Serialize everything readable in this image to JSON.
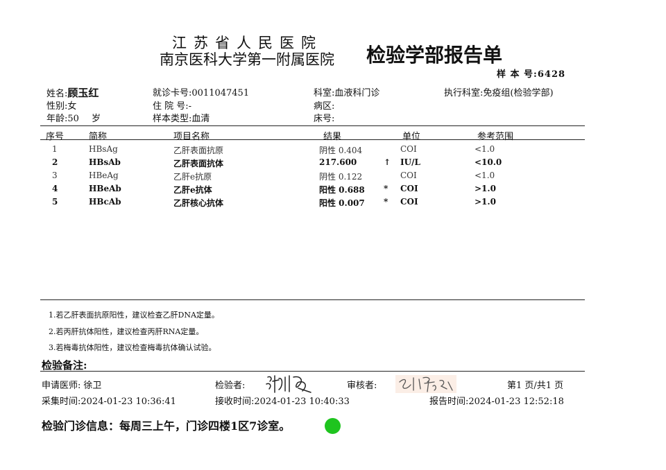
{
  "header": {
    "hospital_line1": "江苏省人民医院",
    "hospital_line2": "南京医科大学第一附属医院",
    "report_title": "检验学部报告单",
    "sample_label": "样 本 号:",
    "sample_no": "6428"
  },
  "patient": {
    "name_label": "姓名:",
    "name": "顾玉红",
    "card_label": "就诊卡号:",
    "card_no": "0011047451",
    "dept_label": "科室:",
    "dept": "血液科门诊",
    "exec_dept_label": "执行科室:",
    "exec_dept": "免疫组(检验学部)",
    "sex_label": "性别:",
    "sex": "女",
    "admission_label": "住 院 号:",
    "admission_no": "-",
    "ward_label": "病区:",
    "ward": "",
    "age_label": "年龄:",
    "age": "50",
    "age_unit": "岁",
    "sample_type_label": "样本类型:",
    "sample_type": "血清",
    "bed_label": "床号:",
    "bed": ""
  },
  "table": {
    "headers": {
      "seq": "序号",
      "abbr": "简称",
      "name": "项目名称",
      "result": "结果",
      "unit": "单位",
      "range": "参考范围"
    },
    "rows": [
      {
        "seq": "1",
        "abbr": "HBsAg",
        "name": "乙肝表面抗原",
        "result": "阴性 0.404",
        "flag": "",
        "unit": "COI",
        "range": "<1.0",
        "bold": false
      },
      {
        "seq": "2",
        "abbr": "HBsAb",
        "name": "乙肝表面抗体",
        "result": "217.600",
        "flag": "↑",
        "unit": "IU/L",
        "range": "<10.0",
        "bold": true
      },
      {
        "seq": "3",
        "abbr": "HBeAg",
        "name": "乙肝e抗原",
        "result": "阴性 0.122",
        "flag": "",
        "unit": "COI",
        "range": "<1.0",
        "bold": false
      },
      {
        "seq": "4",
        "abbr": "HBeAb",
        "name": "乙肝e抗体",
        "result": "阳性 0.688",
        "flag": "*",
        "unit": "COI",
        "range": ">1.0",
        "bold": true
      },
      {
        "seq": "5",
        "abbr": "HBcAb",
        "name": "乙肝核心抗体",
        "result": "阳性 0.007",
        "flag": "*",
        "unit": "COI",
        "range": ">1.0",
        "bold": true
      }
    ]
  },
  "notes": [
    "1.若乙肝表面抗原阳性，建议检查乙肝DNA定量。",
    "2.若丙肝抗体阳性，建议检查丙肝RNA定量。",
    "3.若梅毒抗体阳性，建议检查梅毒抗体确认试验。"
  ],
  "remarks_label": "检验备注:",
  "footer": {
    "doctor_label": "申请医师:",
    "doctor": "徐卫",
    "tester_label": "检验者:",
    "reviewer_label": "审核者:",
    "page_info": "第1 页/共1 页",
    "collect_label": "采集时间:",
    "collect_time": "2024-01-23 10:36:41",
    "receive_label": "接收时间:",
    "receive_time": "2024-01-23 10:40:33",
    "report_label": "报告时间:",
    "report_time": "2024-01-23 12:52:18"
  },
  "clinic_info": "检验门诊信息：每周三上午，门诊四楼1区7诊室。",
  "colors": {
    "status_dot": "#1fc41f"
  }
}
